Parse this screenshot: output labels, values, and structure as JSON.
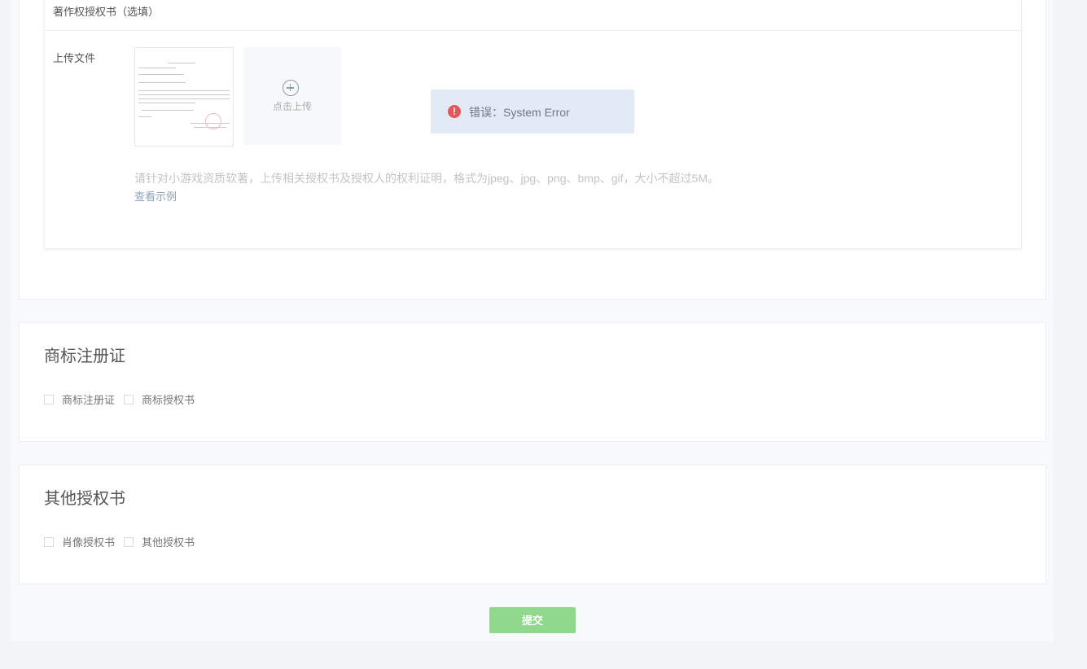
{
  "copyright": {
    "header": "著作权授权书（选填）",
    "upload_label": "上传文件",
    "upload_button": "点击上传",
    "hint": "请针对小游戏资质软著，上传相关授权书及授权人的权利证明，格式为jpeg、jpg、png、bmp、gif，大小不超过5M。",
    "example_link": "查看示例"
  },
  "toast": {
    "icon": "error-icon",
    "icon_glyph": "!",
    "message": "错误：System Error"
  },
  "trademark": {
    "title": "商标注册证",
    "options": [
      "商标注册证",
      "商标授权书"
    ]
  },
  "other": {
    "title": "其他授权书",
    "options": [
      "肖像授权书",
      "其他授权书"
    ]
  },
  "submit_label": "提交"
}
